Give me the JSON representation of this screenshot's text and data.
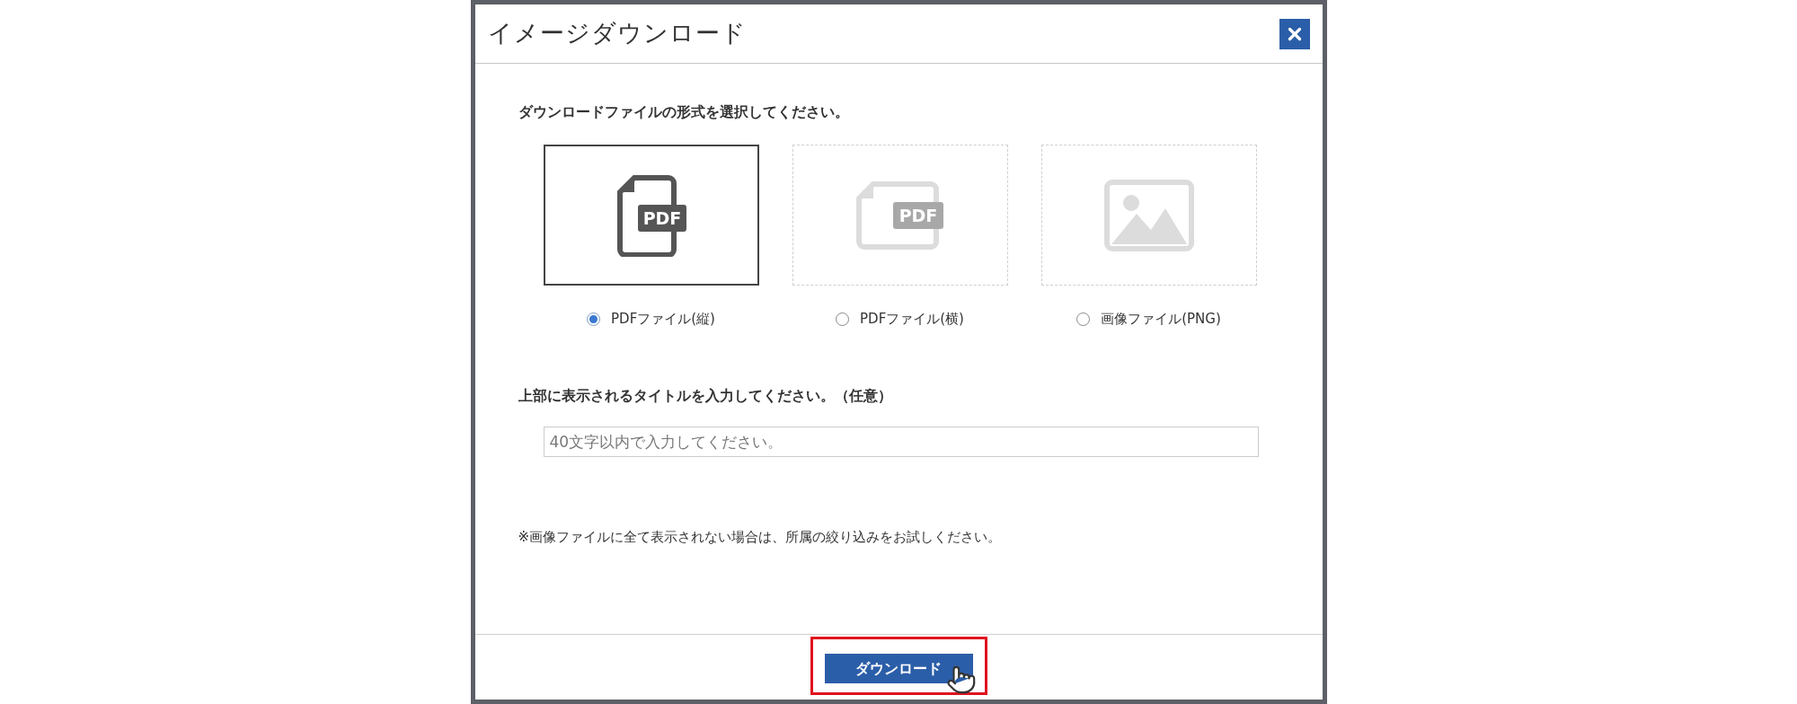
{
  "dialog": {
    "title": "イメージダウンロード",
    "format_prompt": "ダウンロードファイルの形式を選択してください。",
    "formats": [
      {
        "kind": "pdf-portrait",
        "badge": "PDF",
        "label": "PDFファイル(縦)",
        "selected": true
      },
      {
        "kind": "pdf-landscape",
        "badge": "PDF",
        "label": "PDFファイル(横)",
        "selected": false
      },
      {
        "kind": "image",
        "label": "画像ファイル(PNG)",
        "selected": false
      }
    ],
    "title_prompt": "上部に表示されるタイトルを入力してください。（任意）",
    "title_input": {
      "placeholder": "40文字以内で入力してください。"
    },
    "note": "※画像ファイルに全て表示されない場合は、所属の絞り込みをお試しください。",
    "download_button": {
      "label": "ダウンロード",
      "highlighted": true
    }
  }
}
